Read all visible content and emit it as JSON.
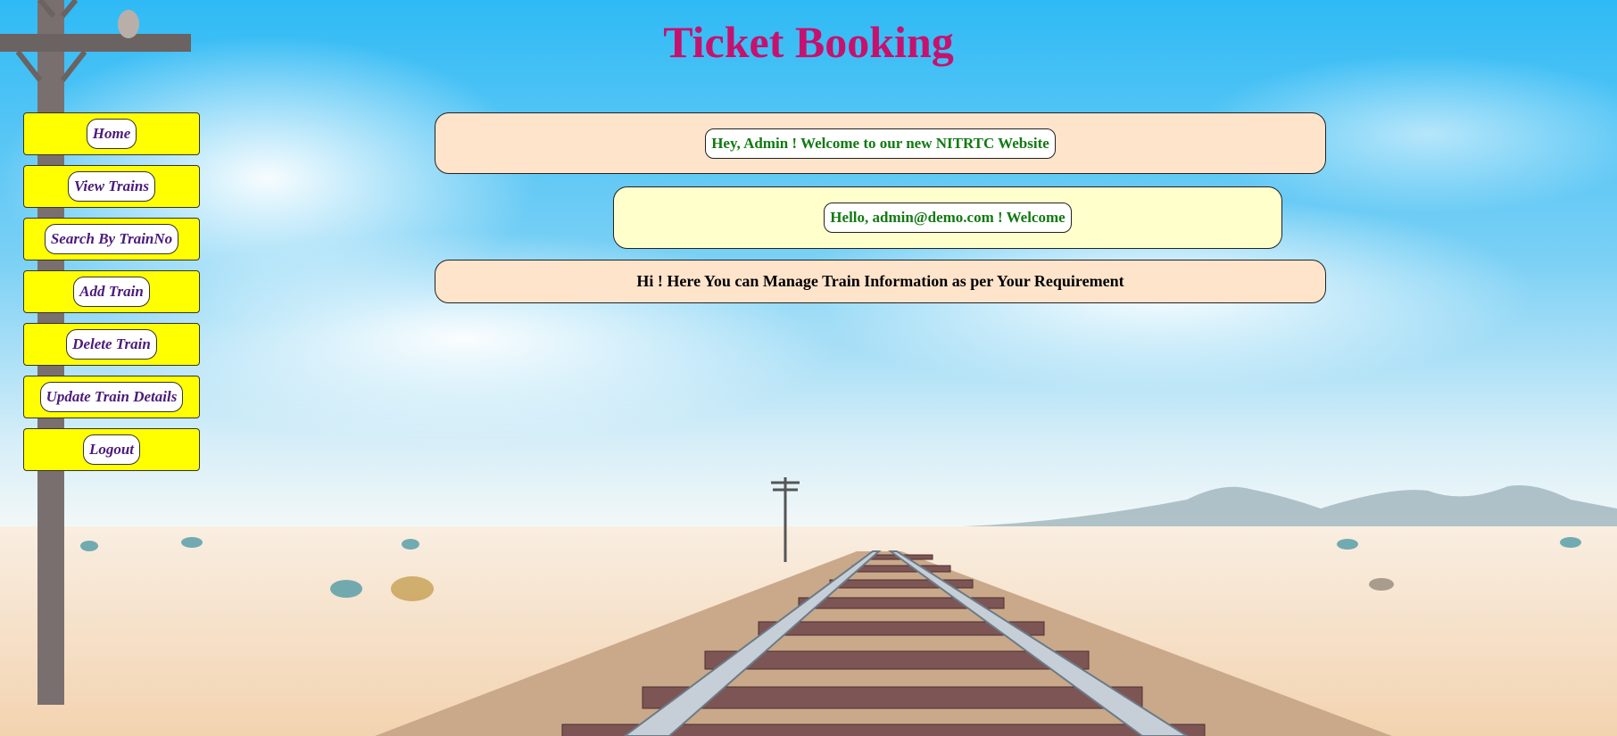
{
  "page": {
    "title": "Ticket Booking"
  },
  "menu": {
    "items": [
      {
        "label": "Home"
      },
      {
        "label": "View Trains"
      },
      {
        "label": "Search By TrainNo"
      },
      {
        "label": "Add Train"
      },
      {
        "label": "Delete Train"
      },
      {
        "label": "Update Train Details"
      },
      {
        "label": "Logout"
      }
    ]
  },
  "messages": {
    "welcome_site": "Hey, Admin ! Welcome to our new NITRTC Website",
    "welcome_user": "Hello, admin@demo.com ! Welcome",
    "manage_info": "Hi ! Here You can Manage Train Information as per Your Requirement"
  },
  "colors": {
    "title": "#c5126e",
    "menu_background": "#ffff00",
    "menu_text": "#4b1a7a",
    "message_green": "#127a12",
    "box_peach": "#ffe4cc",
    "box_cream": "#ffffcc",
    "sky": "#2fbaf5",
    "sand": "#f7dcbc"
  },
  "background": {
    "scene": "railway-track-desert"
  }
}
